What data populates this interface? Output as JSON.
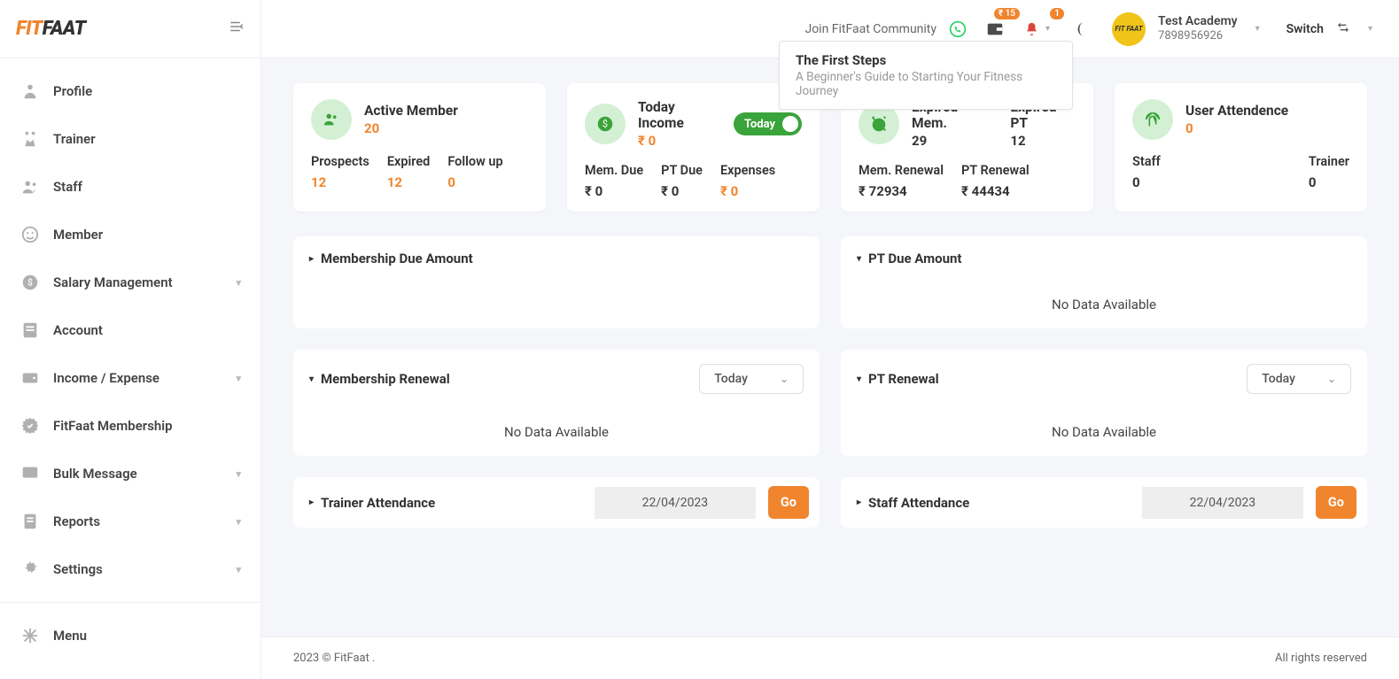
{
  "logo": {
    "part1": "FIT",
    "part2": "FAAT"
  },
  "sidebar": {
    "items": [
      {
        "label": "Profile"
      },
      {
        "label": "Trainer"
      },
      {
        "label": "Staff"
      },
      {
        "label": "Member"
      },
      {
        "label": "Salary Management",
        "expandable": true
      },
      {
        "label": "Account"
      },
      {
        "label": "Income / Expense",
        "expandable": true
      },
      {
        "label": "FitFaat Membership"
      },
      {
        "label": "Bulk Message",
        "expandable": true
      },
      {
        "label": "Reports",
        "expandable": true
      },
      {
        "label": "Settings",
        "expandable": true
      }
    ],
    "menu_label": "Menu"
  },
  "topbar": {
    "community": "Join FitFaat Community",
    "wallet_badge": "₹ 15",
    "bell_badge": "1",
    "account_name": "Test Academy",
    "account_phone": "7898956926",
    "switch": "Switch"
  },
  "popover": {
    "title": "The First Steps",
    "subtitle": "A Beginner's Guide to Starting Your Fitness Journey"
  },
  "cards": {
    "active": {
      "title": "Active Member",
      "value": "20",
      "sub": [
        {
          "label": "Prospects",
          "val": "12"
        },
        {
          "label": "Expired",
          "val": "12"
        },
        {
          "label": "Follow up",
          "val": "0"
        }
      ]
    },
    "income": {
      "title": "Today Income",
      "value": "₹ 0",
      "toggle": "Today",
      "sub": [
        {
          "label": "Mem. Due",
          "val": "₹ 0"
        },
        {
          "label": "PT Due",
          "val": "₹ 0"
        },
        {
          "label": "Expenses",
          "val": "₹ 0"
        }
      ]
    },
    "expired": {
      "title1": "Expired Mem.",
      "val1": "29",
      "title2": "Expired PT",
      "val2": "12",
      "sub": [
        {
          "label": "Mem. Renewal",
          "val": "₹ 72934"
        },
        {
          "label": "PT Renewal",
          "val": "₹ 44434"
        }
      ]
    },
    "attend": {
      "title": "User Attendence",
      "value": "0",
      "sub": [
        {
          "label": "Staff",
          "val": "0"
        },
        {
          "label": "Trainer",
          "val": "0"
        }
      ]
    }
  },
  "panels": {
    "mem_due": {
      "title": "Membership Due Amount"
    },
    "pt_due": {
      "title": "PT Due Amount",
      "body": "No Data Available"
    },
    "mem_renew": {
      "title": "Membership Renewal",
      "select": "Today",
      "body": "No Data Available"
    },
    "pt_renew": {
      "title": "PT Renewal",
      "select": "Today",
      "body": "No Data Available"
    },
    "trainer_att": {
      "title": "Trainer Attendance",
      "date": "22/04/2023",
      "go": "Go"
    },
    "staff_att": {
      "title": "Staff Attendance",
      "date": "22/04/2023",
      "go": "Go"
    }
  },
  "footer": {
    "left": "2023 © FitFaat .",
    "right": "All rights reserved"
  }
}
